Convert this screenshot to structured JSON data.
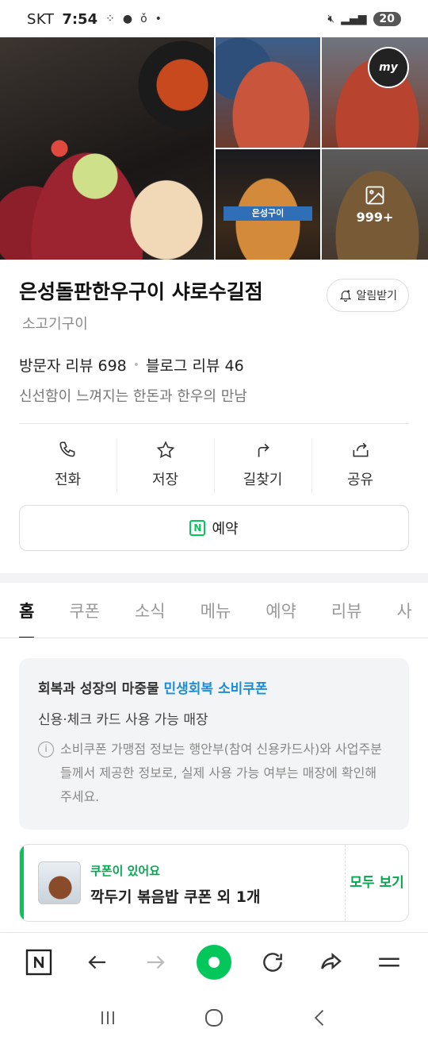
{
  "status_bar": {
    "carrier": "SKT",
    "time": "7:54",
    "battery": "20"
  },
  "photos": {
    "more_count": "999+",
    "storefront_sign": "은성구이",
    "avatar_label": "my"
  },
  "place": {
    "name": "은성돌판한우구이 샤로수길점",
    "category": "소고기구이",
    "alarm_label": "알림받기",
    "visitor_reviews": "방문자 리뷰 698",
    "blog_reviews": "블로그 리뷰 46",
    "description": "신선함이 느껴지는 한돈과 한우의 만남"
  },
  "actions": {
    "call": "전화",
    "save": "저장",
    "directions": "길찾기",
    "share": "공유"
  },
  "reserve_button": "예약",
  "tabs": [
    "홈",
    "쿠폰",
    "소식",
    "메뉴",
    "예약",
    "리뷰",
    "사"
  ],
  "notice": {
    "title_prefix": "회복과 성장의 마중물 ",
    "title_highlight": "민생회복 소비쿠폰",
    "subtitle": "신용·체크 카드 사용 가능 매장",
    "body": "소비쿠폰 가맹점 정보는 행안부(참여 신용카드사)와 사업주분들께서 제공한 정보로, 실제 사용 가능 여부는 매장에 확인해 주세요."
  },
  "coupon": {
    "tag": "쿠폰이 있어요",
    "name": "깍두기 볶음밥 쿠폰 외 1개",
    "view_all": "모두 보기"
  },
  "colors": {
    "naver_green": "#03c75a",
    "highlight_blue": "#1a8fd8"
  }
}
